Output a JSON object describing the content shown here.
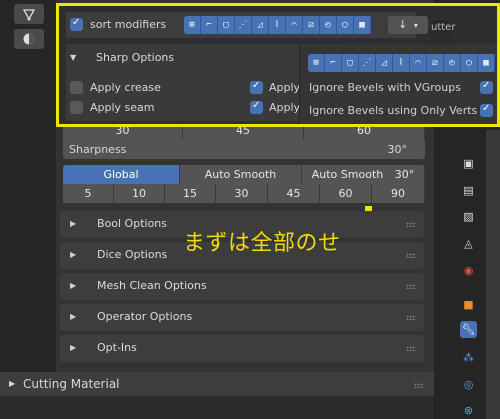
{
  "popup": {
    "sort_modifiers_label": "sort modifiers",
    "sort_icons": [
      "⊞",
      "⌐",
      "▢",
      "⋰",
      "◿",
      "⌇",
      "⌒",
      "⧄",
      "◴",
      "◯",
      "▩"
    ],
    "sort_dropdown": "↓",
    "sharp_options_title": "Sharp Options",
    "apply_crease": "Apply crease",
    "apply_seam": "Apply seam",
    "apply_1": "Apply",
    "apply_2": "Apply",
    "right_icons": [
      "⊞",
      "⌐",
      "▢",
      "⋰",
      "◿",
      "⌇",
      "⌒",
      "⧄",
      "◴",
      "◯",
      "▩"
    ],
    "ignore_vgroups": "Ignore Bevels with VGroups",
    "ignore_verts": "Ignore Bevels using Only Verts",
    "header_fragment": "utter"
  },
  "angles_row": [
    "30",
    "45",
    "60"
  ],
  "sharpness": {
    "label": "Sharpness",
    "value": "30°"
  },
  "mode_tabs": [
    "Global",
    "Auto Smooth",
    "Auto Smooth"
  ],
  "mode_tab_value": "30°",
  "angle_presets": [
    "5",
    "10",
    "15",
    "30",
    "45",
    "60",
    "90"
  ],
  "sections": [
    "Bool Options",
    "Dice Options",
    "Mesh Clean Options",
    "Operator Options",
    "Opt-Ins"
  ],
  "cutting_material": "Cutting Material",
  "annotation": "まずは全部のせ",
  "colors": {
    "accent": "#4772b3",
    "highlight": "#f2e600"
  }
}
